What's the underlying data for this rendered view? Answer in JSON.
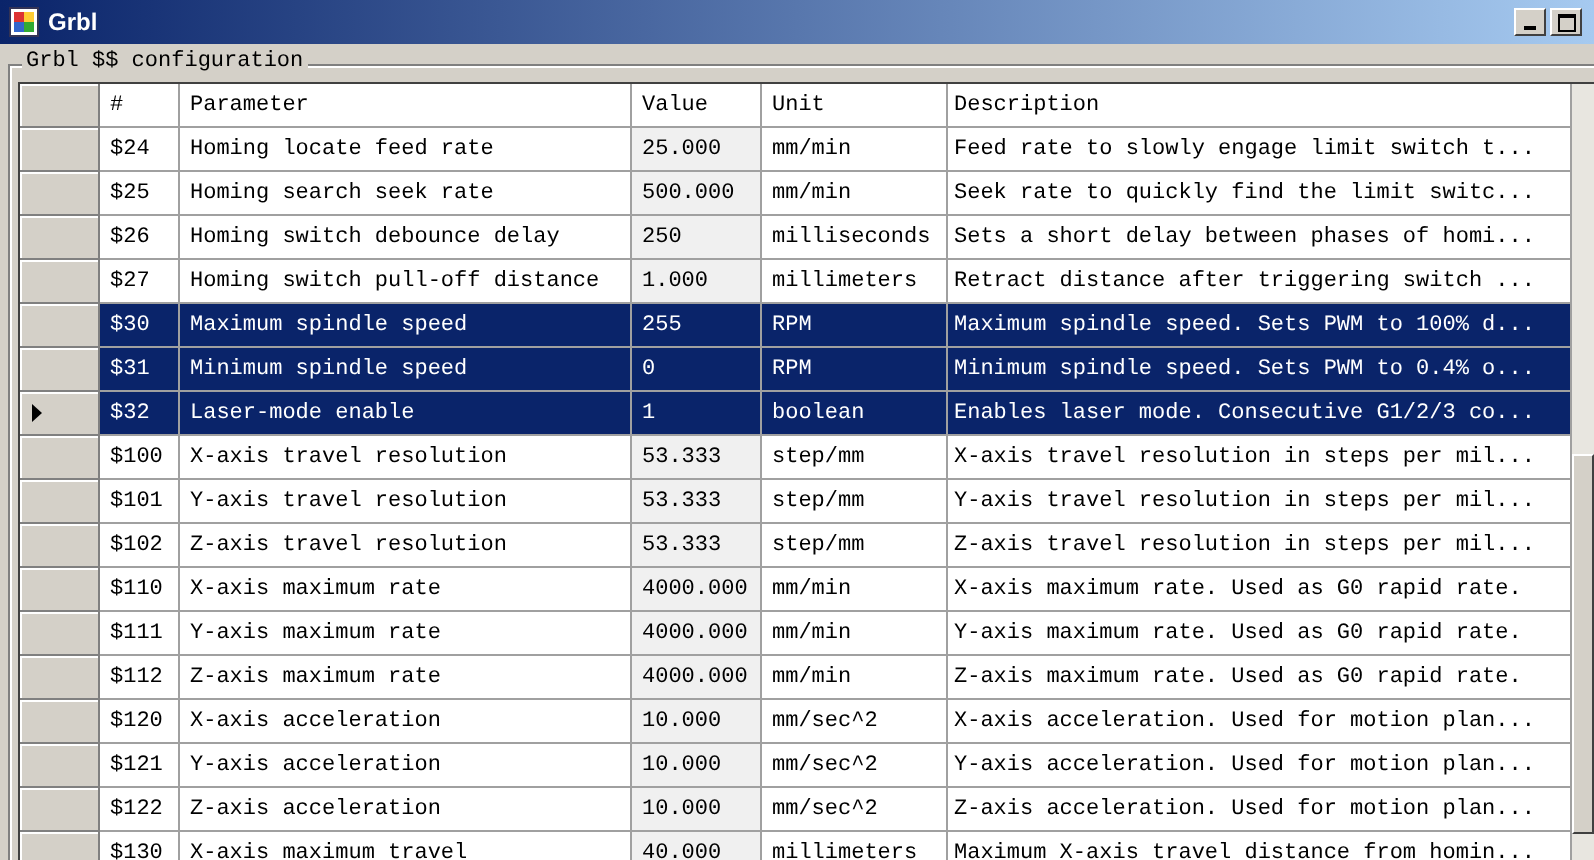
{
  "window": {
    "title": "Grbl"
  },
  "group": {
    "title": "Grbl $$ configuration"
  },
  "table": {
    "columns": [
      "#",
      "Parameter",
      "Value",
      "Unit",
      "Description"
    ],
    "rows": [
      {
        "cells": [
          "$24",
          "Homing locate feed rate",
          "25.000",
          "mm/min",
          "Feed rate to slowly engage limit switch t..."
        ],
        "selected": false,
        "current": false
      },
      {
        "cells": [
          "$25",
          "Homing search seek rate",
          "500.000",
          "mm/min",
          "Seek rate to quickly find the limit switc..."
        ],
        "selected": false,
        "current": false
      },
      {
        "cells": [
          "$26",
          "Homing switch debounce delay",
          "250",
          "milliseconds",
          "Sets a short delay between phases of homi..."
        ],
        "selected": false,
        "current": false
      },
      {
        "cells": [
          "$27",
          "Homing switch pull-off distance",
          "1.000",
          "millimeters",
          "Retract distance after triggering switch ..."
        ],
        "selected": false,
        "current": false
      },
      {
        "cells": [
          "$30",
          "Maximum spindle speed",
          "255",
          "RPM",
          "Maximum spindle speed. Sets PWM to 100% d..."
        ],
        "selected": true,
        "current": false
      },
      {
        "cells": [
          "$31",
          "Minimum spindle speed",
          "0",
          "RPM",
          "Minimum spindle speed. Sets PWM to 0.4% o..."
        ],
        "selected": true,
        "current": false
      },
      {
        "cells": [
          "$32",
          "Laser-mode enable",
          "1",
          "boolean",
          "Enables laser mode. Consecutive G1/2/3 co..."
        ],
        "selected": true,
        "current": true
      },
      {
        "cells": [
          "$100",
          "X-axis travel resolution",
          "53.333",
          "step/mm",
          "X-axis travel resolution in steps per mil..."
        ],
        "selected": false,
        "current": false
      },
      {
        "cells": [
          "$101",
          "Y-axis travel resolution",
          "53.333",
          "step/mm",
          "Y-axis travel resolution in steps per mil..."
        ],
        "selected": false,
        "current": false
      },
      {
        "cells": [
          "$102",
          "Z-axis travel resolution",
          "53.333",
          "step/mm",
          "Z-axis travel resolution in steps per mil..."
        ],
        "selected": false,
        "current": false
      },
      {
        "cells": [
          "$110",
          "X-axis maximum rate",
          "4000.000",
          "mm/min",
          "X-axis maximum rate. Used as G0 rapid rate."
        ],
        "selected": false,
        "current": false
      },
      {
        "cells": [
          "$111",
          "Y-axis maximum rate",
          "4000.000",
          "mm/min",
          "Y-axis maximum rate. Used as G0 rapid rate."
        ],
        "selected": false,
        "current": false
      },
      {
        "cells": [
          "$112",
          "Z-axis maximum rate",
          "4000.000",
          "mm/min",
          "Z-axis maximum rate. Used as G0 rapid rate."
        ],
        "selected": false,
        "current": false
      },
      {
        "cells": [
          "$120",
          "X-axis acceleration",
          "10.000",
          "mm/sec^2",
          "X-axis acceleration. Used for motion plan..."
        ],
        "selected": false,
        "current": false
      },
      {
        "cells": [
          "$121",
          "Y-axis acceleration",
          "10.000",
          "mm/sec^2",
          "Y-axis acceleration. Used for motion plan..."
        ],
        "selected": false,
        "current": false
      },
      {
        "cells": [
          "$122",
          "Z-axis acceleration",
          "10.000",
          "mm/sec^2",
          "Z-axis acceleration. Used for motion plan..."
        ],
        "selected": false,
        "current": false
      },
      {
        "cells": [
          "$130",
          "X-axis maximum travel",
          "40.000",
          "millimeters",
          "Maximum X-axis travel distance from homin..."
        ],
        "selected": false,
        "current": false
      }
    ]
  }
}
